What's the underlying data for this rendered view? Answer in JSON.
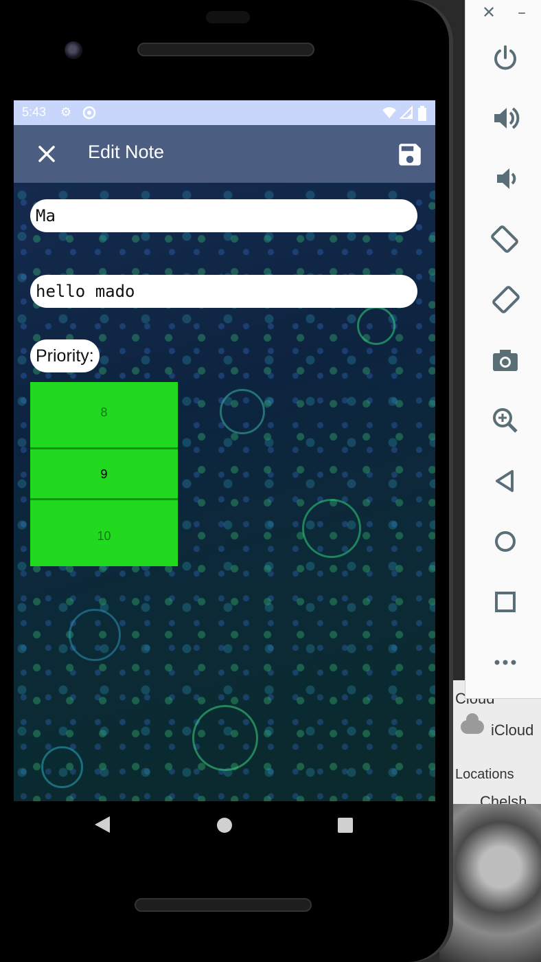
{
  "status_bar": {
    "time": "5:43"
  },
  "app_bar": {
    "title": "Edit Note"
  },
  "form": {
    "title_value": "Ma",
    "description_value": "hello mado",
    "priority_label": "Priority:",
    "priority_options": [
      "8",
      "9",
      "10"
    ],
    "priority_selected": "9"
  },
  "desktop": {
    "cloud_header": "Cloud",
    "icloud": "iCloud",
    "locations": "Locations",
    "partial": "Chelsh"
  },
  "colors": {
    "status_bar": "#c9d6fb",
    "app_bar": "#4b5d80",
    "picker": "#21d91f",
    "toolbar_icon": "#5a6e78"
  },
  "icons": {
    "app_bar": [
      "close-icon",
      "save-icon"
    ],
    "status_bar": [
      "gear-icon",
      "sync-icon",
      "wifi-icon",
      "signal-icon",
      "battery-icon"
    ],
    "nav": [
      "back-icon",
      "home-icon",
      "recents-icon"
    ],
    "emulator_toolbar": [
      "power-icon",
      "volume-up-icon",
      "volume-down-icon",
      "rotate-left-icon",
      "rotate-right-icon",
      "camera-icon",
      "zoom-icon",
      "back-icon",
      "home-icon",
      "overview-icon",
      "more-icon"
    ]
  }
}
